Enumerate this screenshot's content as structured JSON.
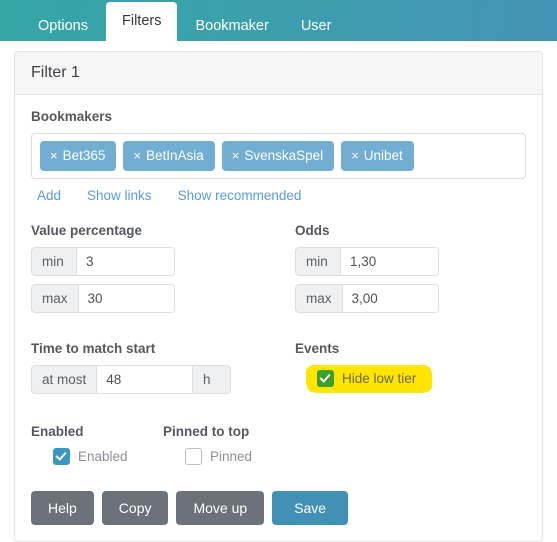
{
  "tabs": [
    {
      "label": "Options",
      "active": false
    },
    {
      "label": "Filters",
      "active": true
    },
    {
      "label": "Bookmaker",
      "active": false
    },
    {
      "label": "User",
      "active": false
    }
  ],
  "panel": {
    "title": "Filter 1",
    "bookmakers": {
      "label": "Bookmakers",
      "tags": [
        {
          "remove": "×",
          "name": "Bet365"
        },
        {
          "remove": "×",
          "name": "BetInAsia"
        },
        {
          "remove": "×",
          "name": "SvenskaSpel"
        },
        {
          "remove": "×",
          "name": "Unibet"
        }
      ],
      "links": [
        {
          "label": "Add"
        },
        {
          "label": "Show links"
        },
        {
          "label": "Show recommended"
        }
      ]
    },
    "value_percentage": {
      "label": "Value percentage",
      "min_addon": "min",
      "min_value": "3",
      "max_addon": "max",
      "max_value": "30"
    },
    "odds": {
      "label": "Odds",
      "min_addon": "min",
      "min_value": "1,30",
      "max_addon": "max",
      "max_value": "3,00"
    },
    "time_to_match_start": {
      "label": "Time to match start",
      "prefix_addon": "at most",
      "value": "48",
      "suffix_addon": "h"
    },
    "events": {
      "label": "Events",
      "hide_low_tier_label": "Hide low tier",
      "hide_low_tier_checked": true,
      "highlight_color": "#ffe500",
      "checkbox_color": "#3d9e28"
    },
    "enabled": {
      "label": "Enabled",
      "checkbox_label": "Enabled",
      "checked": true
    },
    "pinned": {
      "label": "Pinned to top",
      "checkbox_label": "Pinned",
      "checked": false
    },
    "buttons": {
      "help": "Help",
      "copy": "Copy",
      "move_up": "Move up",
      "save": "Save"
    }
  },
  "colors": {
    "tabbar_left": "#34a6a4",
    "tabbar_right": "#4593b6",
    "tag": "#71aed1",
    "primary_button": "#4091b5",
    "default_button": "#6b7279",
    "link": "#5b9bd5"
  }
}
